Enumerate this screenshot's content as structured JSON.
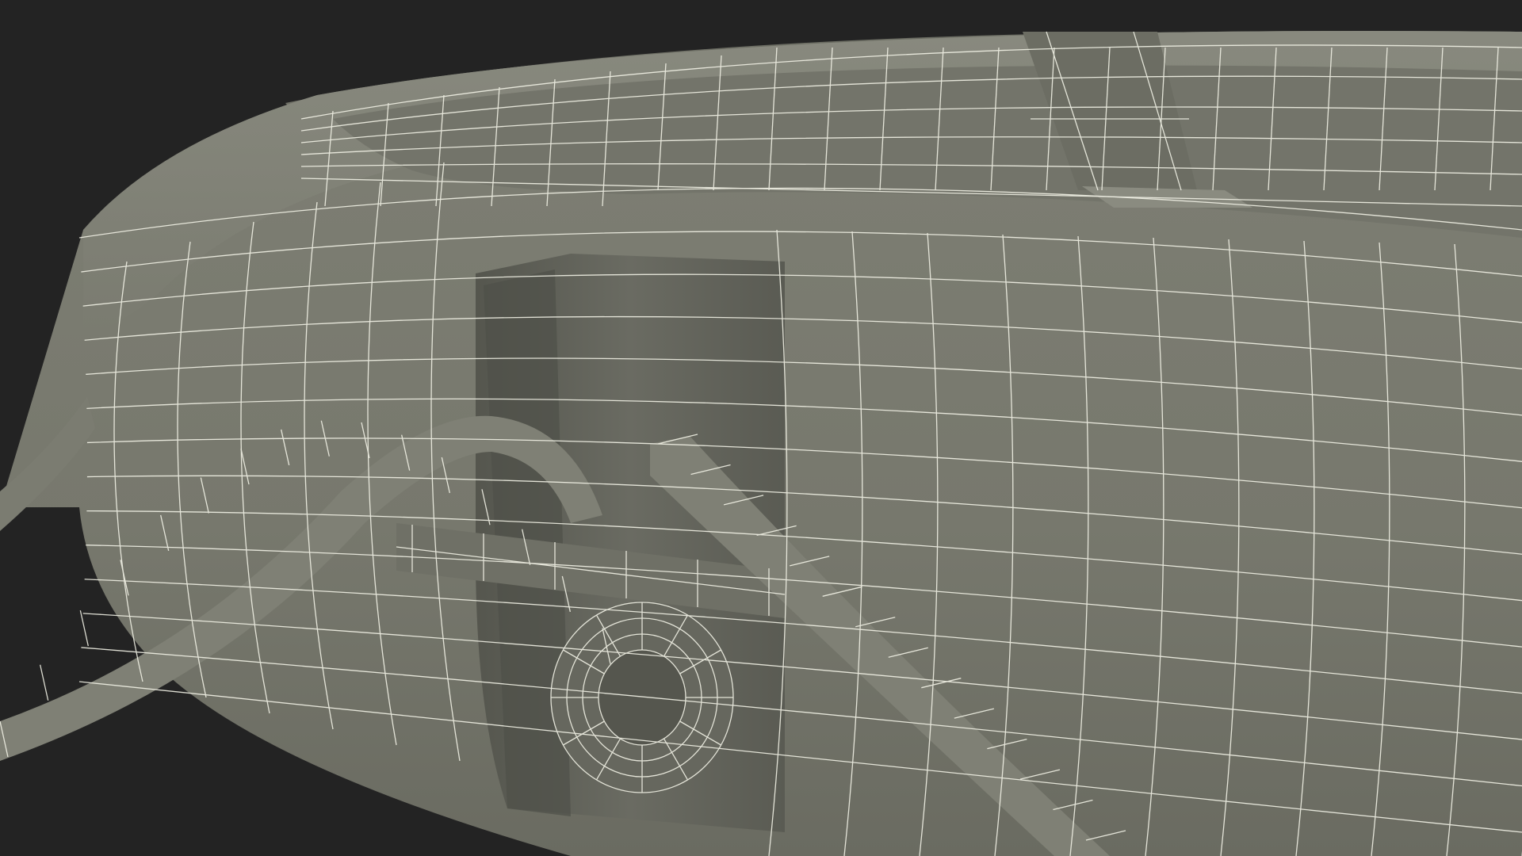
{
  "scene": {
    "subject": "wireframe-lifebuoy-ring",
    "colors": {
      "background": "#232323",
      "surface": "#7a7b70",
      "surface_dark": "#5f6058",
      "surface_shadow": "#4b4c45",
      "surface_light": "#8a8b80",
      "wire": "#f2f2e6"
    }
  }
}
